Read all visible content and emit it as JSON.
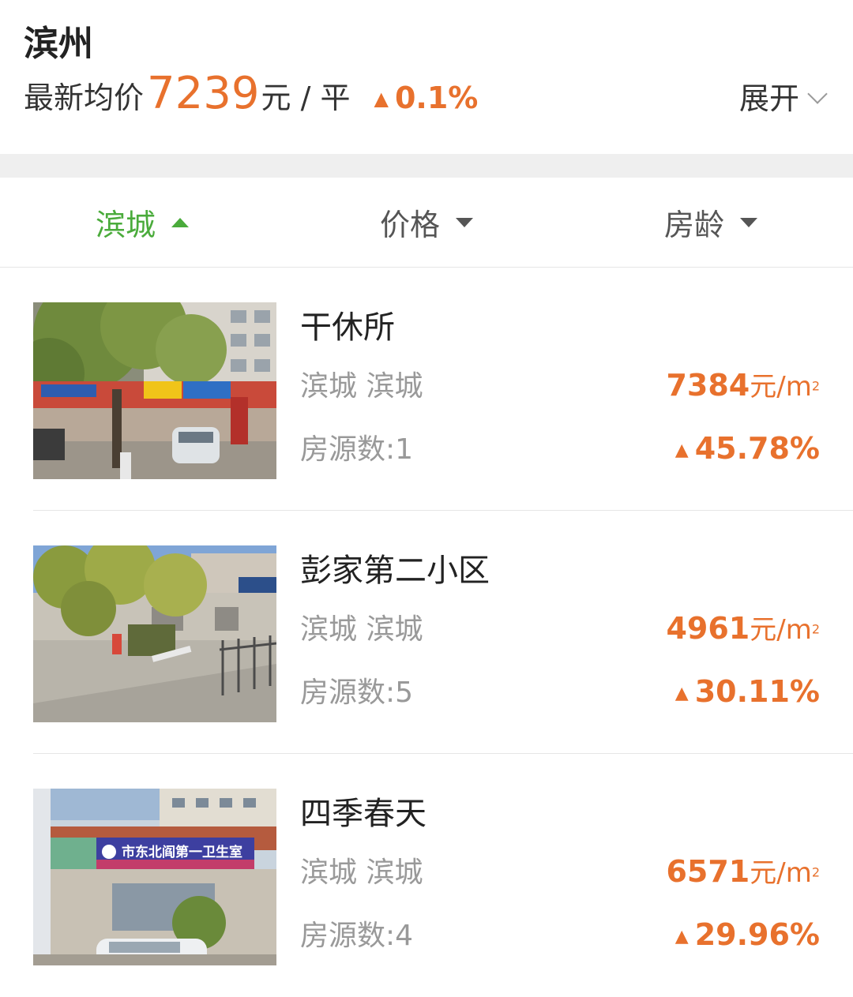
{
  "header": {
    "city": "滨州",
    "avg_label": "最新均价",
    "avg_price": "7239",
    "avg_unit": "元 / 平",
    "change_arrow": "▲",
    "change": "0.1%",
    "expand_label": "展开"
  },
  "filters": [
    {
      "label": "滨城",
      "active": true
    },
    {
      "label": "价格",
      "active": false
    },
    {
      "label": "房龄",
      "active": false
    }
  ],
  "listings": [
    {
      "name": "干休所",
      "area": "滨城 滨城",
      "price": "7384",
      "price_unit": "元/m",
      "price_sup": "2",
      "count": "房源数:1",
      "change_arrow": "▲",
      "change": "45.78%"
    },
    {
      "name": "彭家第二小区",
      "area": "滨城 滨城",
      "price": "4961",
      "price_unit": "元/m",
      "price_sup": "2",
      "count": "房源数:5",
      "change_arrow": "▲",
      "change": "30.11%"
    },
    {
      "name": "四季春天",
      "area": "滨城 滨城",
      "price": "6571",
      "price_unit": "元/m",
      "price_sup": "2",
      "count": "房源数:4",
      "change_arrow": "▲",
      "change": "29.96%"
    }
  ],
  "photo_signs": {
    "clinic_sign": "市东北阎第一卫生室"
  },
  "colors": {
    "accent": "#e8712d",
    "active_filter": "#4aab3b",
    "secondary_text": "#999999"
  }
}
